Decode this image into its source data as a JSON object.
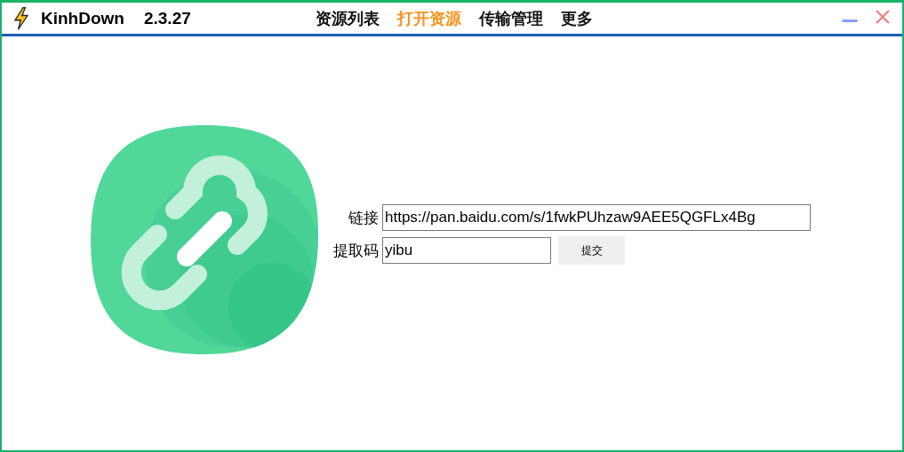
{
  "window": {
    "app_name": "KinhDown",
    "version": "2.3.27"
  },
  "tabs": [
    {
      "label": "资源列表",
      "selected": false
    },
    {
      "label": "打开资源",
      "selected": true
    },
    {
      "label": "传输管理",
      "selected": false
    },
    {
      "label": "更多",
      "selected": false
    }
  ],
  "form": {
    "link": {
      "label": "链接",
      "value": "https://pan.baidu.com/s/1fwkPUhzaw9AEE5QGFLx4Bg"
    },
    "code": {
      "label": "提取码",
      "value": "yibu"
    },
    "submit": "提交"
  }
}
